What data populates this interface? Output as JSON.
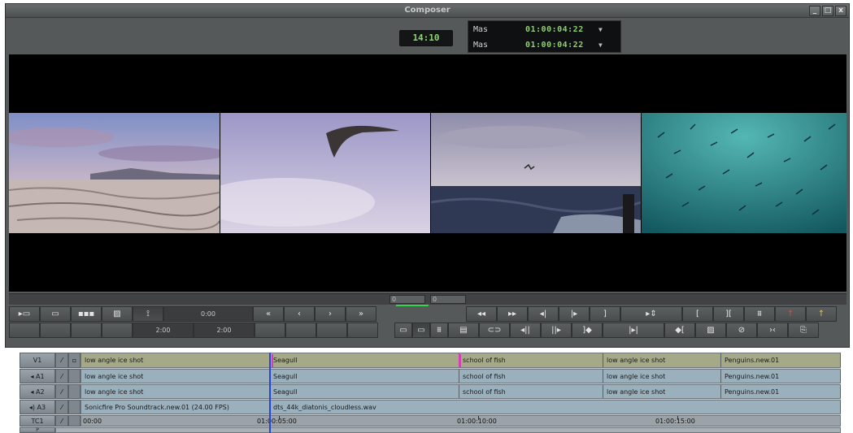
{
  "window": {
    "title": "Composer"
  },
  "window_controls": {
    "minimize": "_",
    "maximize": "□",
    "close": "x"
  },
  "timecode": {
    "main": "14:10",
    "rows": [
      {
        "label": "Mas",
        "value": "01:00:04:22",
        "arrow": "▼"
      },
      {
        "label": "Mas",
        "value": "01:00:04:22",
        "arrow": "▼"
      }
    ]
  },
  "scrub": {
    "position_a": "0",
    "position_b": "0"
  },
  "toolbar_left": {
    "row1": [
      "▸▭",
      "▭",
      "▪▪▪",
      "▨",
      "⟟",
      "0:00",
      "«",
      "‹",
      "›",
      "»"
    ],
    "row2": [
      "",
      "",
      "",
      "",
      "2:00",
      "2:00",
      "",
      "",
      "",
      ""
    ]
  },
  "toolbar_right": {
    "row1": [
      "◂◂",
      "▸▸",
      "◂|",
      "|▸",
      "]",
      "▸⇕",
      "[",
      "][",
      "⩩",
      "↑",
      "↑"
    ],
    "row2": [
      "▭",
      "▭",
      "⩩",
      "▤",
      "⊂⊃",
      "◂||",
      "||▸",
      "]◆",
      "|▸|",
      "◆[",
      "▨",
      "⊘",
      "›‹",
      "⎘"
    ]
  },
  "tracks": {
    "V1": {
      "name": "V1",
      "clips": [
        "low angle ice shot",
        "Seagull",
        "school of fish",
        "low angle ice shot",
        "Penguins.new.01"
      ]
    },
    "A1": {
      "name": "◂ A1",
      "clips": [
        "low angle ice shot",
        "Seagull",
        "school of fish",
        "low angle ice shot",
        "Penguins.new.01"
      ]
    },
    "A2": {
      "name": "◂ A2",
      "clips": [
        "low angle ice shot",
        "Seagull",
        "school of fish",
        "low angle ice shot",
        "Penguins.new.01"
      ]
    },
    "A3": {
      "name": "◂) A3",
      "clips": [
        "Sonicfire Pro Soundtrack.new.01 (24.00 FPS)",
        "dts_44k_diatonis_cloudless.wav"
      ]
    },
    "TC1": {
      "name": "TC1",
      "ticks": [
        "00:00",
        "01:00:05:00",
        "01:00:10:00",
        "01:00:15:00"
      ]
    }
  },
  "track_lock_glyph": "⁄",
  "bottom_track_label": "P",
  "colors": {
    "timecode_green": "#8fd06e",
    "playhead": "#2646d8",
    "marker": "#d43fb5"
  }
}
